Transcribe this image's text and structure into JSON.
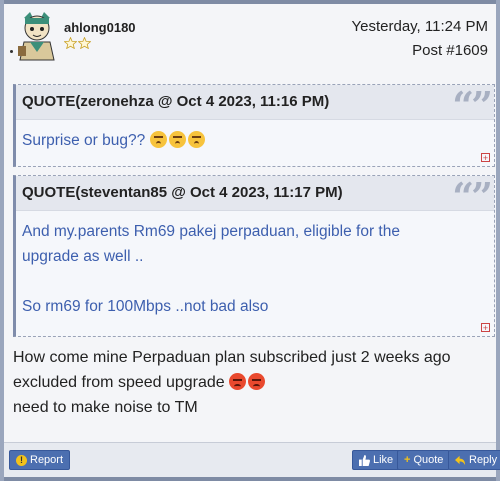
{
  "post": {
    "username": "ahlong0180",
    "timestamp": "Yesterday, 11:24 PM",
    "post_number": "Post #1609",
    "rank_stars": 2,
    "quotes": [
      {
        "header": "QUOTE(zeronehza @ Oct 4 2023, 11:16 PM)",
        "lines": [
          "Surprise or bug??"
        ],
        "emojis": [
          "thinking-face",
          "thinking-face",
          "thinking-face"
        ]
      },
      {
        "header": "QUOTE(steventan85 @ Oct 4 2023, 11:17 PM)",
        "lines": [
          "And my.parents Rm69 pakej perpaduan, eligible for the",
          "upgrade as well ..",
          "",
          "So rm69 for 100Mbps ..not bad also"
        ]
      }
    ],
    "quote_mark": "“”",
    "quote_expand": "+",
    "body_lines": [
      "How come mine Perpaduan plan subscribed just 2 weeks ago",
      "excluded from speed upgrade",
      "need to make noise to TM"
    ],
    "body_emojis": [
      "angry-face",
      "angry-face"
    ]
  },
  "footer": {
    "report_label": "Report",
    "like_label": "Like",
    "quote_label": "Quote",
    "reply_label": "Reply"
  },
  "colors": {
    "accent": "#4c6fb0",
    "quote_text": "#3d5fae",
    "star_outline": "#c9a227"
  }
}
